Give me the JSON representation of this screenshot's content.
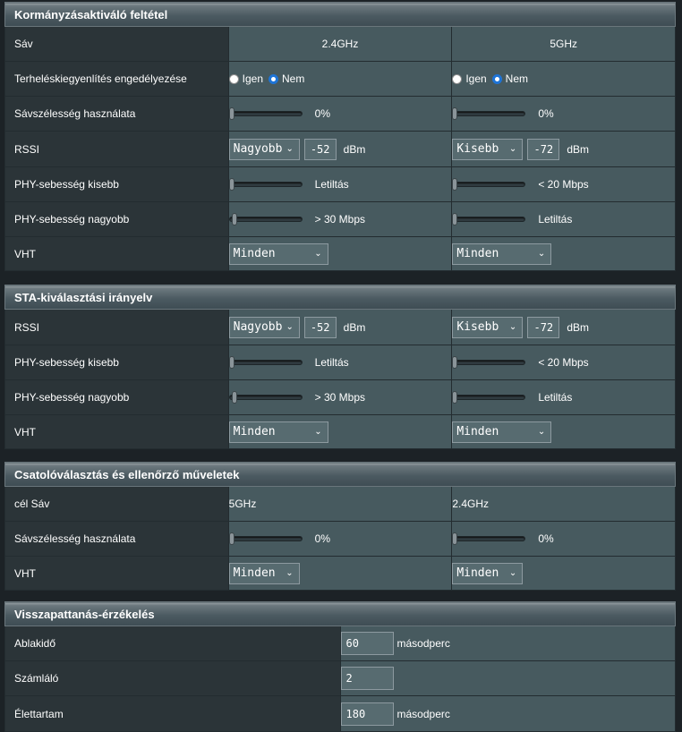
{
  "s1": {
    "title": "Kormányzásaktiváló feltétel",
    "band": {
      "label": "Sáv",
      "v24": "2.4GHz",
      "v5": "5GHz"
    },
    "lb": {
      "label": "Terheléskiegyenlítés engedélyezése",
      "yes": "Igen",
      "no": "Nem",
      "selected24": "Nem",
      "selected5": "Nem"
    },
    "bw": {
      "label": "Sávszélesség használata",
      "v24": "0%",
      "v5": "0%",
      "level24": 0,
      "level5": 0
    },
    "rssi": {
      "label": "RSSI",
      "sel24": "Nagyobb",
      "num24": "-52",
      "sel5": "Kisebb",
      "num5": "-72",
      "unit": "dBm"
    },
    "phyl": {
      "label": "PHY-sebesség kisebb",
      "v24": "Letiltás",
      "v5": "< 20 Mbps",
      "level24": 0,
      "level5": 0
    },
    "phyg": {
      "label": "PHY-sebesség nagyobb",
      "v24": "> 30 Mbps",
      "v5": "Letiltás",
      "level24": 0.05,
      "level5": 0
    },
    "vht": {
      "label": "VHT",
      "v24": "Minden",
      "v5": "Minden"
    }
  },
  "s2": {
    "title": "STA-kiválasztási irányelv",
    "rssi": {
      "label": "RSSI",
      "sel24": "Nagyobb",
      "num24": "-52",
      "sel5": "Kisebb",
      "num5": "-72",
      "unit": "dBm"
    },
    "phyl": {
      "label": "PHY-sebesség kisebb",
      "v24": "Letiltás",
      "v5": "< 20 Mbps",
      "level24": 0,
      "level5": 0
    },
    "phyg": {
      "label": "PHY-sebesség nagyobb",
      "v24": "> 30 Mbps",
      "v5": "Letiltás",
      "level24": 0.05,
      "level5": 0
    },
    "vht": {
      "label": "VHT",
      "v24": "Minden",
      "v5": "Minden"
    }
  },
  "s3": {
    "title": "Csatolóválasztás és ellenőrző műveletek",
    "target": {
      "label": "cél Sáv",
      "v24": "5GHz",
      "v5": "2.4GHz"
    },
    "bw": {
      "label": "Sávszélesség használata",
      "v24": "0%",
      "v5": "0%",
      "level24": 0,
      "level5": 0
    },
    "vht": {
      "label": "VHT",
      "v24": "Minden",
      "v5": "Minden"
    }
  },
  "s4": {
    "title": "Visszapattanás-érzékelés",
    "window": {
      "label": "Ablakidő",
      "value": "60",
      "unit": "másodperc"
    },
    "counter": {
      "label": "Számláló",
      "value": "2"
    },
    "dwell": {
      "label": "Élettartam",
      "value": "180",
      "unit": "másodperc"
    }
  }
}
